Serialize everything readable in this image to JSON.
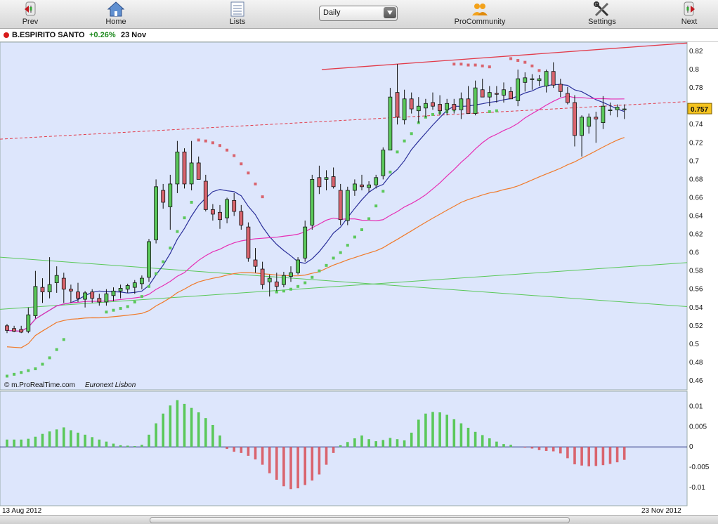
{
  "toolbar": {
    "prev_label": "Prev",
    "home_label": "Home",
    "lists_label": "Lists",
    "period_value": "Daily",
    "procommunity_label": "ProCommunity",
    "settings_label": "Settings",
    "next_label": "Next"
  },
  "header": {
    "instrument": "B.ESPIRITO SANTO",
    "change": "+0.26%",
    "date": "23 Nov",
    "status_color": "#d81b1b"
  },
  "footnote": {
    "source": "© m.ProRealTime.com",
    "exchange": "Euronext Lisbon"
  },
  "x_axis": {
    "start_label": "13 Aug 2012",
    "end_label": "23 Nov 2012"
  },
  "colors": {
    "chart_bg": "#dde6fc",
    "up_candle": "#5ac85a",
    "down_candle": "#d9646e",
    "ma_blue": "#2a2f9a",
    "ma_magenta": "#e62fb4",
    "ma_orange": "#f07a2a",
    "sar_green": "#5cc85c",
    "sar_red": "#d9646e",
    "channel_red": "#e23b4a",
    "trend_green": "#5ac85a",
    "last_price_bg": "#f4c31f"
  },
  "chart_data": [
    {
      "type": "candlestick",
      "ylim": [
        0.45,
        0.83
      ],
      "y_ticks": [
        "0.82",
        "0.8",
        "0.78",
        "0.76",
        "0.74",
        "0.72",
        "0.7",
        "0.68",
        "0.66",
        "0.64",
        "0.62",
        "0.6",
        "0.58",
        "0.56",
        "0.54",
        "0.52",
        "0.5",
        "0.48",
        "0.46"
      ],
      "last_price": "0.757",
      "ohlc": [
        [
          0.52,
          0.522,
          0.512,
          0.515
        ],
        [
          0.517,
          0.52,
          0.513,
          0.514
        ],
        [
          0.516,
          0.52,
          0.512,
          0.513
        ],
        [
          0.514,
          0.54,
          0.512,
          0.532
        ],
        [
          0.531,
          0.58,
          0.528,
          0.563
        ],
        [
          0.562,
          0.572,
          0.545,
          0.557
        ],
        [
          0.557,
          0.595,
          0.55,
          0.565
        ],
        [
          0.567,
          0.585,
          0.556,
          0.575
        ],
        [
          0.572,
          0.578,
          0.545,
          0.56
        ],
        [
          0.56,
          0.565,
          0.545,
          0.558
        ],
        [
          0.557,
          0.567,
          0.546,
          0.55
        ],
        [
          0.549,
          0.558,
          0.54,
          0.556
        ],
        [
          0.557,
          0.56,
          0.545,
          0.55
        ],
        [
          0.55,
          0.555,
          0.542,
          0.546
        ],
        [
          0.546,
          0.56,
          0.542,
          0.555
        ],
        [
          0.553,
          0.562,
          0.547,
          0.558
        ],
        [
          0.558,
          0.565,
          0.55,
          0.561
        ],
        [
          0.56,
          0.566,
          0.556,
          0.564
        ],
        [
          0.562,
          0.57,
          0.555,
          0.567
        ],
        [
          0.566,
          0.575,
          0.56,
          0.572
        ],
        [
          0.573,
          0.615,
          0.568,
          0.612
        ],
        [
          0.614,
          0.68,
          0.61,
          0.672
        ],
        [
          0.668,
          0.675,
          0.648,
          0.655
        ],
        [
          0.65,
          0.685,
          0.625,
          0.675
        ],
        [
          0.675,
          0.722,
          0.665,
          0.71
        ],
        [
          0.71,
          0.714,
          0.67,
          0.675
        ],
        [
          0.675,
          0.722,
          0.668,
          0.698
        ],
        [
          0.698,
          0.705,
          0.68,
          0.68
        ],
        [
          0.678,
          0.685,
          0.645,
          0.647
        ],
        [
          0.647,
          0.653,
          0.635,
          0.642
        ],
        [
          0.644,
          0.652,
          0.626,
          0.636
        ],
        [
          0.638,
          0.66,
          0.632,
          0.658
        ],
        [
          0.657,
          0.665,
          0.64,
          0.645
        ],
        [
          0.645,
          0.652,
          0.625,
          0.63
        ],
        [
          0.628,
          0.633,
          0.59,
          0.594
        ],
        [
          0.592,
          0.605,
          0.578,
          0.585
        ],
        [
          0.582,
          0.59,
          0.56,
          0.565
        ],
        [
          0.568,
          0.576,
          0.552,
          0.572
        ],
        [
          0.568,
          0.578,
          0.558,
          0.563
        ],
        [
          0.565,
          0.579,
          0.562,
          0.575
        ],
        [
          0.574,
          0.585,
          0.568,
          0.578
        ],
        [
          0.578,
          0.595,
          0.576,
          0.592
        ],
        [
          0.594,
          0.635,
          0.59,
          0.628
        ],
        [
          0.63,
          0.685,
          0.625,
          0.68
        ],
        [
          0.682,
          0.695,
          0.664,
          0.672
        ],
        [
          0.68,
          0.69,
          0.668,
          0.682
        ],
        [
          0.683,
          0.693,
          0.67,
          0.672
        ],
        [
          0.668,
          0.675,
          0.63,
          0.636
        ],
        [
          0.635,
          0.672,
          0.63,
          0.668
        ],
        [
          0.668,
          0.68,
          0.662,
          0.675
        ],
        [
          0.674,
          0.685,
          0.668,
          0.672
        ],
        [
          0.671,
          0.678,
          0.666,
          0.674
        ],
        [
          0.674,
          0.685,
          0.67,
          0.682
        ],
        [
          0.684,
          0.715,
          0.68,
          0.712
        ],
        [
          0.712,
          0.78,
          0.738,
          0.77
        ],
        [
          0.775,
          0.806,
          0.74,
          0.748
        ],
        [
          0.745,
          0.778,
          0.74,
          0.768
        ],
        [
          0.768,
          0.775,
          0.752,
          0.757
        ],
        [
          0.755,
          0.77,
          0.742,
          0.76
        ],
        [
          0.758,
          0.768,
          0.748,
          0.763
        ],
        [
          0.764,
          0.775,
          0.756,
          0.76
        ],
        [
          0.762,
          0.772,
          0.75,
          0.755
        ],
        [
          0.756,
          0.768,
          0.75,
          0.763
        ],
        [
          0.762,
          0.768,
          0.752,
          0.756
        ],
        [
          0.756,
          0.775,
          0.746,
          0.768
        ],
        [
          0.768,
          0.782,
          0.752,
          0.752
        ],
        [
          0.752,
          0.788,
          0.75,
          0.78
        ],
        [
          0.778,
          0.79,
          0.77,
          0.77
        ],
        [
          0.77,
          0.782,
          0.76,
          0.775
        ],
        [
          0.774,
          0.782,
          0.764,
          0.773
        ],
        [
          0.772,
          0.786,
          0.764,
          0.778
        ],
        [
          0.776,
          0.781,
          0.768,
          0.768
        ],
        [
          0.766,
          0.8,
          0.76,
          0.79
        ],
        [
          0.786,
          0.797,
          0.776,
          0.791
        ],
        [
          0.789,
          0.795,
          0.778,
          0.79
        ],
        [
          0.788,
          0.794,
          0.782,
          0.79
        ],
        [
          0.782,
          0.8,
          0.775,
          0.798
        ],
        [
          0.798,
          0.808,
          0.78,
          0.783
        ],
        [
          0.784,
          0.79,
          0.77,
          0.776
        ],
        [
          0.774,
          0.781,
          0.762,
          0.764
        ],
        [
          0.764,
          0.772,
          0.716,
          0.728
        ],
        [
          0.728,
          0.75,
          0.705,
          0.748
        ],
        [
          0.738,
          0.752,
          0.73,
          0.748
        ],
        [
          0.748,
          0.754,
          0.72,
          0.746
        ],
        [
          0.742,
          0.771,
          0.735,
          0.76
        ],
        [
          0.756,
          0.764,
          0.75,
          0.756
        ],
        [
          0.756,
          0.762,
          0.748,
          0.759
        ],
        [
          0.757,
          0.762,
          0.746,
          0.757
        ]
      ],
      "sar": {
        "green": [
          [
            0,
            0.465
          ],
          [
            1,
            0.467
          ],
          [
            2,
            0.469
          ],
          [
            3,
            0.471
          ],
          [
            4,
            0.473
          ],
          [
            5,
            0.478
          ],
          [
            6,
            0.485
          ],
          [
            7,
            0.494
          ],
          [
            8,
            0.505
          ],
          [
            14,
            0.535
          ],
          [
            15,
            0.537
          ],
          [
            16,
            0.539
          ],
          [
            17,
            0.541
          ],
          [
            18,
            0.546
          ],
          [
            19,
            0.552
          ],
          [
            20,
            0.563
          ],
          [
            21,
            0.577
          ],
          [
            22,
            0.59
          ],
          [
            23,
            0.605
          ],
          [
            24,
            0.623
          ],
          [
            25,
            0.638
          ],
          [
            26,
            0.655
          ],
          [
            38,
            0.557
          ],
          [
            39,
            0.558
          ],
          [
            40,
            0.56
          ],
          [
            41,
            0.563
          ],
          [
            42,
            0.567
          ],
          [
            43,
            0.573
          ],
          [
            44,
            0.58
          ],
          [
            45,
            0.586
          ],
          [
            46,
            0.594
          ],
          [
            47,
            0.6
          ],
          [
            48,
            0.608
          ],
          [
            49,
            0.617
          ],
          [
            50,
            0.625
          ],
          [
            51,
            0.637
          ],
          [
            52,
            0.651
          ],
          [
            53,
            0.667
          ],
          [
            54,
            0.688
          ],
          [
            55,
            0.71
          ],
          [
            56,
            0.722
          ],
          [
            57,
            0.73
          ],
          [
            58,
            0.742
          ],
          [
            59,
            0.748
          ],
          [
            60,
            0.751
          ],
          [
            61,
            0.753
          ],
          [
            62,
            0.754
          ],
          [
            63,
            0.756
          ],
          [
            64,
            0.758
          ],
          [
            65,
            0.76
          ],
          [
            68,
            0.754
          ],
          [
            69,
            0.755
          ]
        ],
        "red": [
          [
            27,
            0.723
          ],
          [
            28,
            0.722
          ],
          [
            29,
            0.72
          ],
          [
            30,
            0.717
          ],
          [
            31,
            0.712
          ],
          [
            32,
            0.706
          ],
          [
            33,
            0.697
          ],
          [
            34,
            0.687
          ],
          [
            35,
            0.675
          ],
          [
            36,
            0.661
          ],
          [
            63,
            0.806
          ],
          [
            64,
            0.806
          ],
          [
            65,
            0.805
          ],
          [
            66,
            0.805
          ],
          [
            67,
            0.804
          ],
          [
            68,
            0.803
          ],
          [
            71,
            0.812
          ],
          [
            72,
            0.81
          ],
          [
            73,
            0.808
          ],
          [
            74,
            0.804
          ],
          [
            75,
            0.799
          ],
          [
            76,
            0.794
          ]
        ]
      }
    },
    {
      "type": "bar",
      "title": "histogram",
      "ylim": [
        -0.0145,
        0.0137
      ],
      "y_ticks": [
        "0.01",
        "0.005",
        "0",
        "-0.005",
        "-0.01"
      ],
      "values": [
        0.0018,
        0.0018,
        0.0018,
        0.002,
        0.0025,
        0.0032,
        0.0038,
        0.0043,
        0.0048,
        0.0041,
        0.0035,
        0.003,
        0.0024,
        0.0018,
        0.0013,
        0.0008,
        0.0004,
        0.0003,
        0.0002,
        0.0005,
        0.003,
        0.0058,
        0.0082,
        0.0102,
        0.0115,
        0.0106,
        0.0096,
        0.0085,
        0.0071,
        0.0054,
        0.0028,
        -0.0005,
        -0.0012,
        -0.0015,
        -0.0022,
        -0.0031,
        -0.0044,
        -0.0065,
        -0.0081,
        -0.0097,
        -0.0104,
        -0.0102,
        -0.0094,
        -0.0083,
        -0.0068,
        -0.0044,
        -0.0015,
        0.0004,
        0.0012,
        0.0021,
        0.0028,
        0.0019,
        0.0014,
        0.0017,
        0.0022,
        0.0019,
        0.0016,
        0.0035,
        0.0067,
        0.0082,
        0.0086,
        0.0085,
        0.0079,
        0.0068,
        0.0058,
        0.0047,
        0.0037,
        0.0029,
        0.0021,
        0.0013,
        0.0007,
        0.0005,
        0,
        -0.0002,
        -0.0004,
        -0.0008,
        -0.001,
        -0.0011,
        -0.0016,
        -0.0028,
        -0.0043,
        -0.0046,
        -0.0048,
        -0.0047,
        -0.0045,
        -0.0042,
        -0.0038,
        -0.0032
      ]
    }
  ]
}
